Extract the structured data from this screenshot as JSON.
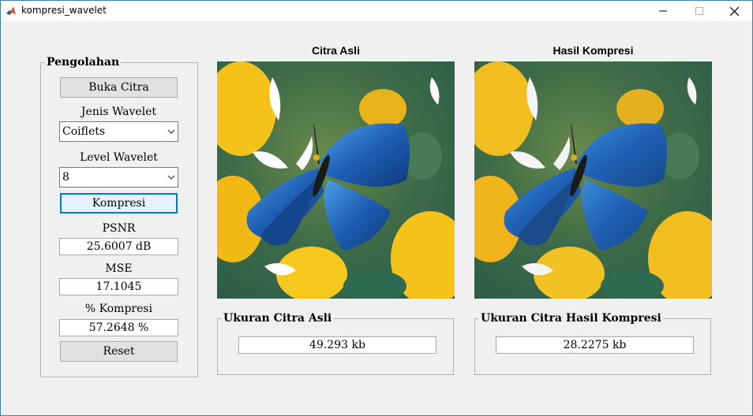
{
  "window": {
    "title": "kompresi_wavelet",
    "minimize_glyph": "—",
    "maximize_glyph": "☐",
    "close_glyph": "✕"
  },
  "panel": {
    "title": "Pengolahan",
    "open_button": "Buka Citra",
    "wavelet_label": "Jenis Wavelet",
    "wavelet_selected": "Coiflets",
    "level_label": "Level Wavelet",
    "level_selected": "8",
    "compress_button": "Kompresi",
    "psnr_label": "PSNR",
    "psnr_value": "25.6007 dB",
    "mse_label": "MSE",
    "mse_value": "17.1045",
    "ratio_label": "% Kompresi",
    "ratio_value": "57.2648 %",
    "reset_button": "Reset"
  },
  "original": {
    "title": "Citra Asli",
    "size_label": "Ukuran Citra Asli",
    "size_value": "49.293 kb"
  },
  "compressed": {
    "title": "Hasil Kompresi",
    "size_label": "Ukuran Citra Hasil Kompresi",
    "size_value": "28.2275 kb"
  },
  "icons": {
    "app": "matlab-icon",
    "dropdown": "chevron-down-icon"
  },
  "colors": {
    "focus_border": "#0078d7",
    "butterfly_blue": "#1e5fb4",
    "flower_yellow": "#f5c21a"
  }
}
